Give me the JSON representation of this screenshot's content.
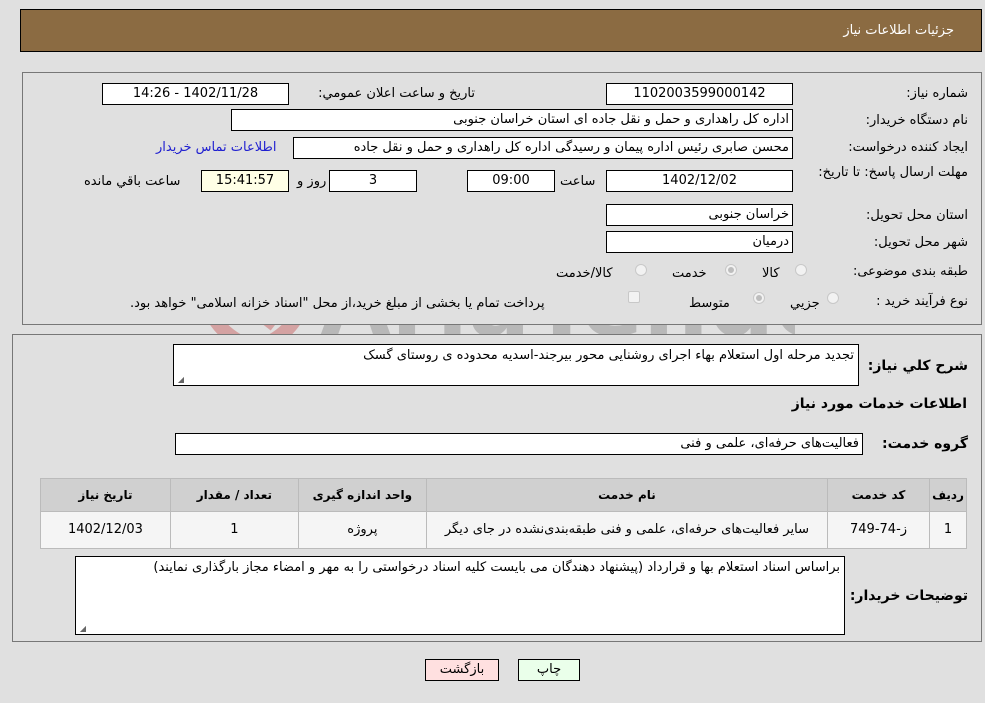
{
  "header": {
    "title": "جزئیات اطلاعات نیاز"
  },
  "details": {
    "need_number_label": "شماره نیاز:",
    "need_number": "1102003599000142",
    "announce_label": "تاریخ و ساعت اعلان عمومي:",
    "announce_value": "1402/11/28 - 14:26",
    "buyer_org_label": "نام دستگاه خریدار:",
    "buyer_org": "اداره کل راهداری و حمل و نقل جاده ای استان خراسان جنوبی",
    "creator_label": "ایجاد کننده درخواست:",
    "creator": "محسن صابری رئیس اداره پیمان و رسیدگی اداره کل راهداری و حمل و نقل جاده",
    "contact_link": "اطلاعات تماس خریدار",
    "deadline_label": "مهلت ارسال پاسخ: تا تاریخ:",
    "deadline_date": "1402/12/02",
    "time_label": "ساعت",
    "deadline_time": "09:00",
    "days_value": "3",
    "days_label": "روز و",
    "remaining_time": "15:41:57",
    "remaining_label": "ساعت باقي مانده",
    "province_label": "استان محل تحویل:",
    "province": "خراسان جنوبی",
    "city_label": "شهر محل تحویل:",
    "city": "درمیان",
    "category_label": "طبقه بندی موضوعی:",
    "category_options": [
      "کالا",
      "خدمت",
      "کالا/خدمت"
    ],
    "category_selected": "خدمت",
    "process_label": "نوع فرآیند خرید :",
    "process_options": [
      "جزیي",
      "متوسط"
    ],
    "process_selected": "متوسط",
    "treasury_note": "پرداخت تمام یا بخشی از مبلغ خرید،از محل \"اسناد خزانه اسلامی\" خواهد بود."
  },
  "summary": {
    "label": "شرح كلي نياز:",
    "text": "تجدید مرحله اول استعلام بهاء اجرای روشنایی محور بیرجند-اسدیه محدوده ی روستای گسک"
  },
  "services": {
    "section_title": "اطلاعات خدمات مورد نیاز",
    "group_label": "گروه خدمت:",
    "group_value": "فعالیت‌های حرفه‌ای، علمی و فنی",
    "columns": [
      "ردیف",
      "کد خدمت",
      "نام خدمت",
      "واحد اندازه گیری",
      "تعداد / مقدار",
      "تاریخ نیاز"
    ],
    "rows": [
      {
        "index": "1",
        "code": "ز-74-749",
        "name": "سایر فعالیت‌های حرفه‌ای، علمی و فنی طبقه‌بندی‌نشده در جای دیگر",
        "unit": "پروژه",
        "qty": "1",
        "date": "1402/12/03"
      }
    ]
  },
  "buyer_notes": {
    "label": "توضیحات خریدار:",
    "text": "براساس اسناد استعلام بها و قرارداد (پیشنهاد دهندگان می بایست کلیه اسناد درخواستی را به مهر و امضاء مجاز بارگذاری نمایند)"
  },
  "buttons": {
    "back": "بازگشت",
    "print": "چاپ"
  },
  "watermark": {
    "text": "AriaTender.neT"
  }
}
